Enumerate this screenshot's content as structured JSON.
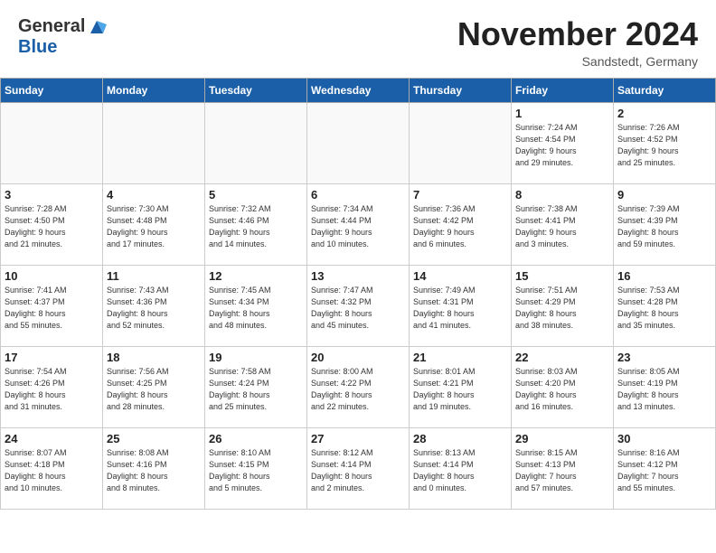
{
  "header": {
    "logo_general": "General",
    "logo_blue": "Blue",
    "month_title": "November 2024",
    "subtitle": "Sandstedt, Germany"
  },
  "weekdays": [
    "Sunday",
    "Monday",
    "Tuesday",
    "Wednesday",
    "Thursday",
    "Friday",
    "Saturday"
  ],
  "weeks": [
    [
      {
        "day": "",
        "info": ""
      },
      {
        "day": "",
        "info": ""
      },
      {
        "day": "",
        "info": ""
      },
      {
        "day": "",
        "info": ""
      },
      {
        "day": "",
        "info": ""
      },
      {
        "day": "1",
        "info": "Sunrise: 7:24 AM\nSunset: 4:54 PM\nDaylight: 9 hours\nand 29 minutes."
      },
      {
        "day": "2",
        "info": "Sunrise: 7:26 AM\nSunset: 4:52 PM\nDaylight: 9 hours\nand 25 minutes."
      }
    ],
    [
      {
        "day": "3",
        "info": "Sunrise: 7:28 AM\nSunset: 4:50 PM\nDaylight: 9 hours\nand 21 minutes."
      },
      {
        "day": "4",
        "info": "Sunrise: 7:30 AM\nSunset: 4:48 PM\nDaylight: 9 hours\nand 17 minutes."
      },
      {
        "day": "5",
        "info": "Sunrise: 7:32 AM\nSunset: 4:46 PM\nDaylight: 9 hours\nand 14 minutes."
      },
      {
        "day": "6",
        "info": "Sunrise: 7:34 AM\nSunset: 4:44 PM\nDaylight: 9 hours\nand 10 minutes."
      },
      {
        "day": "7",
        "info": "Sunrise: 7:36 AM\nSunset: 4:42 PM\nDaylight: 9 hours\nand 6 minutes."
      },
      {
        "day": "8",
        "info": "Sunrise: 7:38 AM\nSunset: 4:41 PM\nDaylight: 9 hours\nand 3 minutes."
      },
      {
        "day": "9",
        "info": "Sunrise: 7:39 AM\nSunset: 4:39 PM\nDaylight: 8 hours\nand 59 minutes."
      }
    ],
    [
      {
        "day": "10",
        "info": "Sunrise: 7:41 AM\nSunset: 4:37 PM\nDaylight: 8 hours\nand 55 minutes."
      },
      {
        "day": "11",
        "info": "Sunrise: 7:43 AM\nSunset: 4:36 PM\nDaylight: 8 hours\nand 52 minutes."
      },
      {
        "day": "12",
        "info": "Sunrise: 7:45 AM\nSunset: 4:34 PM\nDaylight: 8 hours\nand 48 minutes."
      },
      {
        "day": "13",
        "info": "Sunrise: 7:47 AM\nSunset: 4:32 PM\nDaylight: 8 hours\nand 45 minutes."
      },
      {
        "day": "14",
        "info": "Sunrise: 7:49 AM\nSunset: 4:31 PM\nDaylight: 8 hours\nand 41 minutes."
      },
      {
        "day": "15",
        "info": "Sunrise: 7:51 AM\nSunset: 4:29 PM\nDaylight: 8 hours\nand 38 minutes."
      },
      {
        "day": "16",
        "info": "Sunrise: 7:53 AM\nSunset: 4:28 PM\nDaylight: 8 hours\nand 35 minutes."
      }
    ],
    [
      {
        "day": "17",
        "info": "Sunrise: 7:54 AM\nSunset: 4:26 PM\nDaylight: 8 hours\nand 31 minutes."
      },
      {
        "day": "18",
        "info": "Sunrise: 7:56 AM\nSunset: 4:25 PM\nDaylight: 8 hours\nand 28 minutes."
      },
      {
        "day": "19",
        "info": "Sunrise: 7:58 AM\nSunset: 4:24 PM\nDaylight: 8 hours\nand 25 minutes."
      },
      {
        "day": "20",
        "info": "Sunrise: 8:00 AM\nSunset: 4:22 PM\nDaylight: 8 hours\nand 22 minutes."
      },
      {
        "day": "21",
        "info": "Sunrise: 8:01 AM\nSunset: 4:21 PM\nDaylight: 8 hours\nand 19 minutes."
      },
      {
        "day": "22",
        "info": "Sunrise: 8:03 AM\nSunset: 4:20 PM\nDaylight: 8 hours\nand 16 minutes."
      },
      {
        "day": "23",
        "info": "Sunrise: 8:05 AM\nSunset: 4:19 PM\nDaylight: 8 hours\nand 13 minutes."
      }
    ],
    [
      {
        "day": "24",
        "info": "Sunrise: 8:07 AM\nSunset: 4:18 PM\nDaylight: 8 hours\nand 10 minutes."
      },
      {
        "day": "25",
        "info": "Sunrise: 8:08 AM\nSunset: 4:16 PM\nDaylight: 8 hours\nand 8 minutes."
      },
      {
        "day": "26",
        "info": "Sunrise: 8:10 AM\nSunset: 4:15 PM\nDaylight: 8 hours\nand 5 minutes."
      },
      {
        "day": "27",
        "info": "Sunrise: 8:12 AM\nSunset: 4:14 PM\nDaylight: 8 hours\nand 2 minutes."
      },
      {
        "day": "28",
        "info": "Sunrise: 8:13 AM\nSunset: 4:14 PM\nDaylight: 8 hours\nand 0 minutes."
      },
      {
        "day": "29",
        "info": "Sunrise: 8:15 AM\nSunset: 4:13 PM\nDaylight: 7 hours\nand 57 minutes."
      },
      {
        "day": "30",
        "info": "Sunrise: 8:16 AM\nSunset: 4:12 PM\nDaylight: 7 hours\nand 55 minutes."
      }
    ]
  ]
}
